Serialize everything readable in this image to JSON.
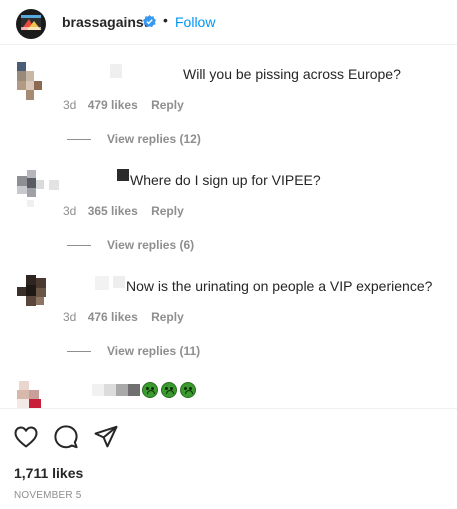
{
  "header": {
    "username": "brassagainst",
    "separator": "•",
    "follow_label": "Follow",
    "verified_icon": "verified-badge-icon"
  },
  "comments": [
    {
      "text": "Will you be pissing across Europe?",
      "age": "3d",
      "likes": "479 likes",
      "reply_label": "Reply",
      "view_replies": "View replies (12)"
    },
    {
      "text": "Where do I sign up for VIPEE?",
      "age": "3d",
      "likes": "365 likes",
      "reply_label": "Reply",
      "view_replies": "View replies (6)"
    },
    {
      "text": "Now is the urinating on people a VIP experience?",
      "age": "3d",
      "likes": "476 likes",
      "reply_label": "Reply",
      "view_replies": "View replies (11)"
    },
    {
      "text": "",
      "emojis": [
        "nauseated-face-icon",
        "nauseated-face-icon",
        "nauseated-face-icon"
      ]
    }
  ],
  "actions": {
    "like_icon": "heart-icon",
    "comment_icon": "comment-bubble-icon",
    "share_icon": "paper-plane-icon"
  },
  "likes_total": "1,711 likes",
  "post_date": "NOVEMBER 5",
  "colors": {
    "accent": "#0095f6",
    "muted": "#8e8e8e",
    "text": "#262626"
  }
}
